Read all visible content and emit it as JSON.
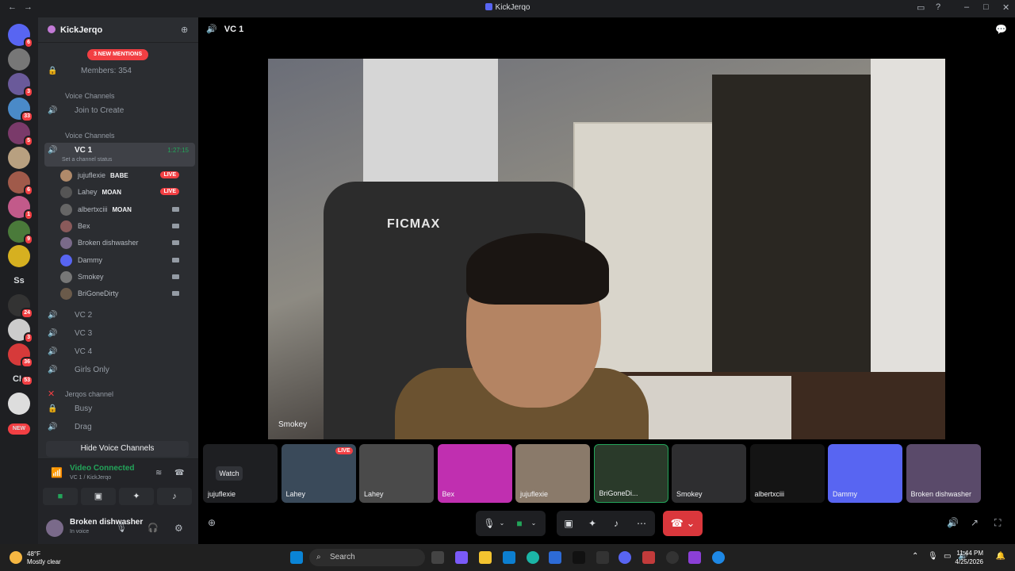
{
  "window": {
    "title": "KickJerqo"
  },
  "guilds": [
    {
      "badge": "6"
    },
    {
      "badge": ""
    },
    {
      "badge": "3"
    },
    {
      "badge": "33"
    },
    {
      "badge": "5"
    },
    {
      "badge": ""
    },
    {
      "badge": "6"
    },
    {
      "badge": "1"
    },
    {
      "badge": "9"
    },
    {
      "badge": ""
    },
    {
      "text": "Ss",
      "badge": ""
    },
    {
      "badge": "24"
    },
    {
      "badge": "3"
    },
    {
      "badge": "36"
    },
    {
      "text": "CH",
      "badge": "53"
    },
    {
      "badge": ""
    },
    {
      "text": "NEW",
      "badge": ""
    }
  ],
  "server": {
    "name": "KickJerqo",
    "mentions": "3 NEW MENTIONS",
    "members": "Members: 354",
    "cat1": "Voice Channels",
    "join": "Join to Create",
    "cat2": "Voice Channels",
    "vc1": {
      "name": "VC 1",
      "timer": "1:27:15",
      "status": "Set a channel status"
    },
    "users": [
      {
        "name": "jujuflexie",
        "tag": "BABE",
        "live": "LIVE",
        "color": "#b08a6a"
      },
      {
        "name": "Lahey",
        "tag": "MOAN",
        "live": "LIVE",
        "color": "#555"
      },
      {
        "name": "albertxciii",
        "tag": "MOAN",
        "live": "",
        "color": "#666"
      },
      {
        "name": "Bex",
        "tag": "",
        "live": "",
        "color": "#8a5a5a"
      },
      {
        "name": "Broken dishwasher",
        "tag": "",
        "live": "",
        "color": "#7a6a8a"
      },
      {
        "name": "Dammy",
        "tag": "",
        "live": "",
        "color": "#5865f2"
      },
      {
        "name": "Smokey",
        "tag": "",
        "live": "",
        "color": "#777"
      },
      {
        "name": "BriGoneDirty",
        "tag": "",
        "live": "",
        "color": "#6a5a4a"
      }
    ],
    "vc2": "VC 2",
    "vc3": "VC 3",
    "vc4": "VC 4",
    "girls": "Girls Only",
    "jerqos": "Jerqos channel",
    "busy": "Busy",
    "drag": "Drag",
    "hide": "Hide Voice Channels"
  },
  "voice": {
    "connected": "Video Connected",
    "sub": "VC 1 / KickJerqo",
    "user": "Broken dishwasher",
    "status": "In voice"
  },
  "main": {
    "channel": "VC 1",
    "stage_name": "Smokey",
    "stage_brand": "FICMAX",
    "watch": "Watch",
    "tiles": [
      {
        "name": "jujuflexie",
        "live": "",
        "color": "#1e1f22"
      },
      {
        "name": "Lahey",
        "live": "LIVE",
        "color": "#3a4a5a"
      },
      {
        "name": "Lahey",
        "live": "",
        "color": "#4a4a4a"
      },
      {
        "name": "Bex",
        "live": "",
        "color": "#c02fb0"
      },
      {
        "name": "jujuflexie",
        "live": "",
        "color": "#8a7a6a"
      },
      {
        "name": "BriGoneDi...",
        "live": "",
        "color": "#2a3a2a"
      },
      {
        "name": "Smokey",
        "live": "",
        "color": "#2e2e30"
      },
      {
        "name": "albertxciii",
        "live": "",
        "color": "#141414"
      },
      {
        "name": "Dammy",
        "live": "",
        "color": "#5865f2"
      },
      {
        "name": "Broken dishwasher",
        "live": "",
        "color": "#5a4a6a"
      }
    ]
  },
  "taskbar": {
    "temp": "48°F",
    "weather": "Mostly clear",
    "search": "Search",
    "time": "11:44 PM",
    "date": "4/25/2026"
  }
}
